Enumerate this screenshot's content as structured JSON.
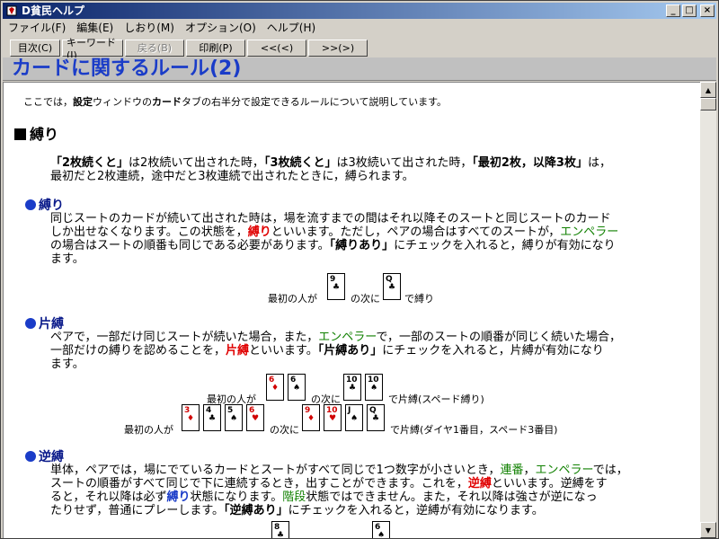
{
  "window": {
    "title": "D貧民ヘルプ",
    "buttons": {
      "minimize": "_",
      "maximize": "□",
      "close": "×"
    }
  },
  "menu": [
    "ファイル(F)",
    "編集(E)",
    "しおり(M)",
    "オプション(O)",
    "ヘルプ(H)"
  ],
  "toolbar": [
    {
      "label": "目次(C)",
      "disabled": false
    },
    {
      "label": "キーワード(I)",
      "disabled": false
    },
    {
      "label": "戻る(B)",
      "disabled": true
    },
    {
      "label": "印刷(P)",
      "disabled": false
    },
    {
      "label": "<<(<)",
      "disabled": false
    },
    {
      "label": ">>(>)",
      "disabled": false
    }
  ],
  "heading": "カードに関するルール(2)",
  "intro": {
    "pre": "ここでは，",
    "w1": "設定",
    "mid1": "ウィンドウの",
    "w2": "カード",
    "post": "タブの右半分で設定できるルールについて説明しています。"
  },
  "section": "縛り",
  "overview": {
    "t1": "「2枚続くと」",
    "t2": "は2枚続いて出された時，",
    "t3": "「3枚続くと」",
    "t4": "は3枚続いて出された時，",
    "t5": "「最初2枚，以降3枚」",
    "t6": "は，",
    "line2": "最初だと2枚連続，途中だと3枚連続で出されたときに，縛られます。"
  },
  "shibari": {
    "title": "縛り",
    "l1": "同じスートのカードが続いて出された時は，場を流すまでの間はそれ以降そのスートと同じスートのカード",
    "l2a": "しか出せなくなります。この状態を，",
    "l2b": "縛り",
    "l2c": "といいます。ただし，ペアの場合はすべてのスートが，",
    "l2d": "エンペラー",
    "l3a": "の場合はスートの順番も同じである必要があります。",
    "l3b": "「縛りあり」",
    "l3c": "にチェックを入れると，縛りが有効になり",
    "l4": "ます。",
    "cap1": "最初の人が",
    "cap2": "の次に",
    "cap3": "で縛り"
  },
  "katashibari": {
    "title": "片縛",
    "l1a": "ペアで，一部だけ同じスートが続いた場合，また，",
    "l1b": "エンペラー",
    "l1c": "で，一部のスートの順番が同じく続いた場合，",
    "l2a": "一部だけの縛りを認めることを，",
    "l2b": "片縛",
    "l2c": "といいます。",
    "l2d": "「片縛あり」",
    "l2e": "にチェックを入れると，片縛が有効になり",
    "l3": "ます。",
    "r1cap1": "最初の人が",
    "r1cap2": "の次に",
    "r1cap3": "で片縛(スペード縛り)",
    "r2cap1": "最初の人が",
    "r2cap2": "の次に",
    "r2cap3": "で片縛(ダイヤ1番目，スペード3番目)"
  },
  "gyakushibari": {
    "title": "逆縛",
    "l1a": "単体，ペアでは，場にでているカードとスートがすべて同じで1つ数字が小さいとき，",
    "l1b": "連番",
    "l1c": "，",
    "l1d": "エンペラー",
    "l1e": "では，",
    "l2a": "スートの順番がすべて同じで下に連続するとき，出すことができます。これを，",
    "l2b": "逆縛",
    "l2c": "といいます。逆縛をす",
    "l3a": "ると，それ以降は必ず",
    "l3b": "縛り",
    "l3c": "状態になります。",
    "l3d": "階段",
    "l3e": "状態ではできません。また，それ以降は強さが逆になっ",
    "l4a": "たりせず，普通にプレーします。",
    "l4b": "「逆縛あり」",
    "l4c": "にチェックを入れると，逆縛が有効になります。"
  },
  "cards": {
    "shibari": [
      {
        "rank": "9",
        "suit": "♣"
      },
      {
        "rank": "Q",
        "suit": "♣"
      }
    ],
    "kata_row1": [
      {
        "rank": "6",
        "suit": "♦"
      },
      {
        "rank": "6",
        "suit": "♠"
      },
      {
        "rank": "10",
        "suit": "♣"
      },
      {
        "rank": "10",
        "suit": "♠"
      }
    ],
    "kata_row2": [
      {
        "rank": "3",
        "suit": "♦"
      },
      {
        "rank": "4",
        "suit": "♣"
      },
      {
        "rank": "5",
        "suit": "♠"
      },
      {
        "rank": "6",
        "suit": "♥"
      },
      {
        "rank": "9",
        "suit": "♦"
      },
      {
        "rank": "10",
        "suit": "♥"
      },
      {
        "rank": "J",
        "suit": "♠"
      },
      {
        "rank": "Q",
        "suit": "♣"
      }
    ],
    "gyaku": [
      {
        "rank": "8",
        "suit": "♣"
      },
      {
        "rank": "6",
        "suit": "♠"
      }
    ]
  }
}
